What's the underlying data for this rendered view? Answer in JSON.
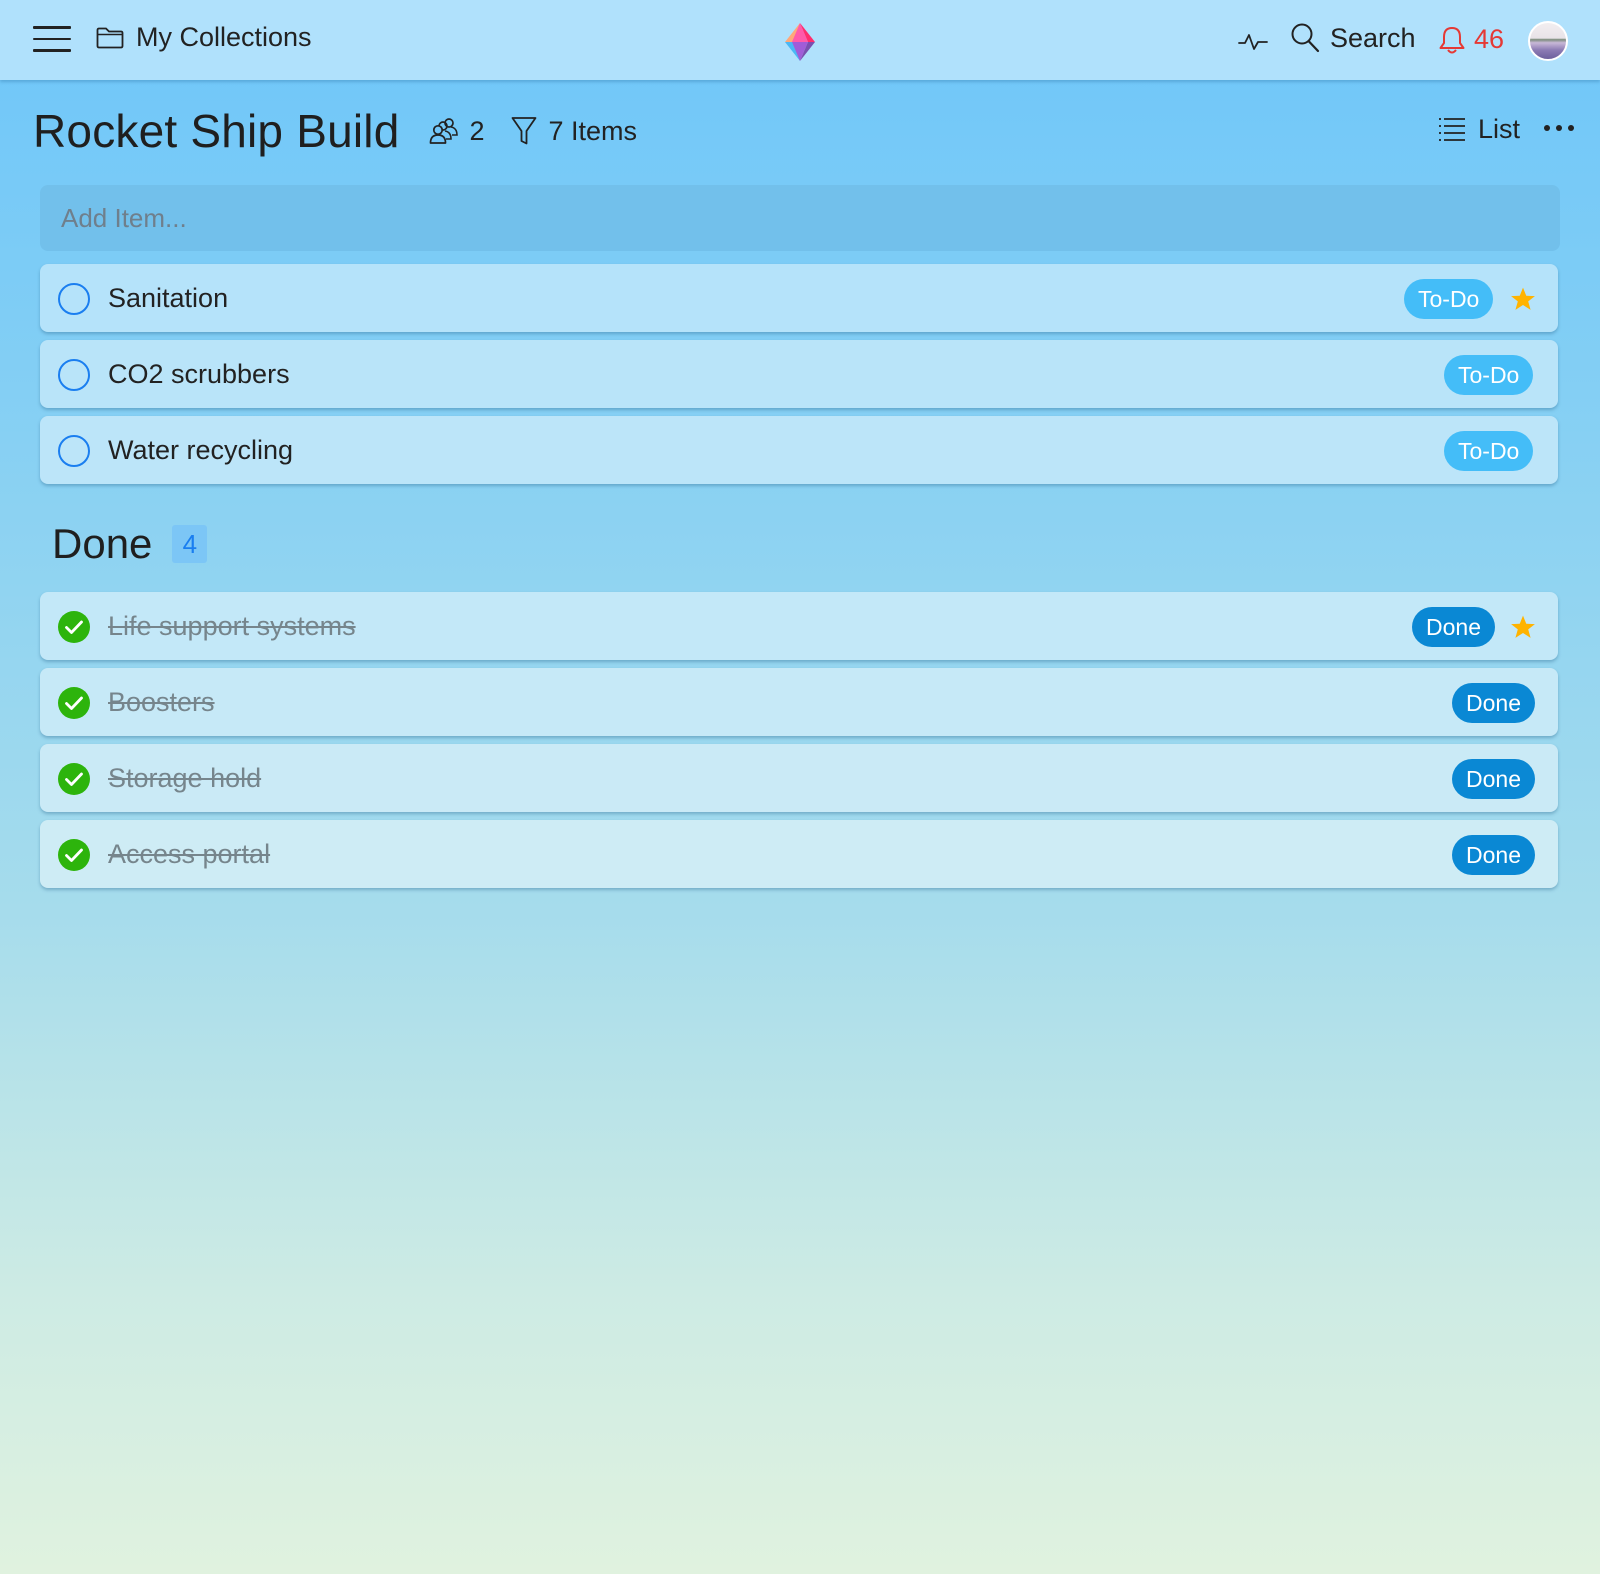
{
  "topbar": {
    "menu_icon": "hamburger-icon",
    "collections_label": "My Collections",
    "collections_icon": "folder-icon",
    "logo": "gem-logo",
    "activity_icon": "pulse-icon",
    "search_label": "Search",
    "search_icon": "search-icon",
    "notification_icon": "bell-icon",
    "notification_count": "46",
    "avatar": "user-avatar"
  },
  "header": {
    "title": "Rocket Ship Build",
    "members_icon": "people-icon",
    "members_count": "2",
    "filter_icon": "filter-icon",
    "items_label": "7 Items",
    "view_icon": "list-icon",
    "view_label": "List",
    "more_icon": "ellipsis-icon"
  },
  "add_item": {
    "placeholder": "Add Item..."
  },
  "todo_items": [
    {
      "title": "Sanitation",
      "status": "To-Do",
      "starred": true
    },
    {
      "title": "CO2 scrubbers",
      "status": "To-Do",
      "starred": false
    },
    {
      "title": "Water recycling",
      "status": "To-Do",
      "starred": false
    }
  ],
  "done_section": {
    "label": "Done",
    "count": "4"
  },
  "done_items": [
    {
      "title": "Life support systems",
      "status": "Done",
      "starred": true
    },
    {
      "title": "Boosters",
      "status": "Done",
      "starred": false
    },
    {
      "title": "Storage hold",
      "status": "Done",
      "starred": false
    },
    {
      "title": "Access portal",
      "status": "Done",
      "starred": false
    }
  ],
  "colors": {
    "todo_badge": "#44bdf8",
    "done_badge": "#0a88d4",
    "check_green": "#2db40c",
    "circle_blue": "#1a7ef0",
    "star": "#ffb300",
    "notification_red": "#e53935"
  }
}
